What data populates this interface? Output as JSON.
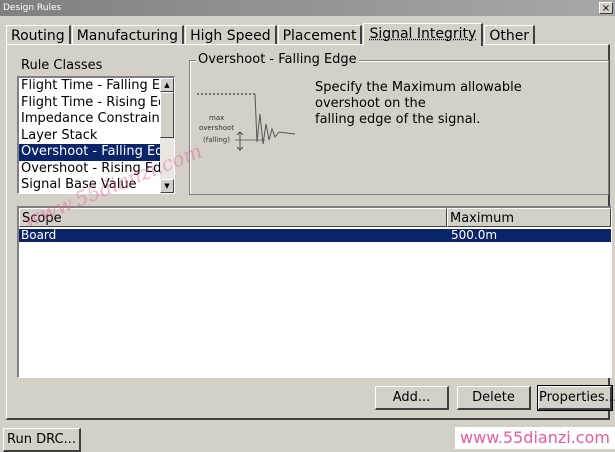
{
  "window": {
    "title": "Design Rules",
    "close_glyph": "×"
  },
  "tabs": [
    {
      "label": "Routing",
      "active": false
    },
    {
      "label": "Manufacturing",
      "active": false
    },
    {
      "label": "High Speed",
      "active": false
    },
    {
      "label": "Placement",
      "active": false
    },
    {
      "label": "Signal Integrity",
      "active": true
    },
    {
      "label": "Other",
      "active": false
    }
  ],
  "rule_classes": {
    "label": "Rule Classes",
    "items": [
      "Flight Time - Falling Edge",
      "Flight Time - Rising Edge",
      "Impedance Constraint",
      "Layer Stack",
      "Overshoot - Falling Edge",
      "Overshoot - Rising Edge",
      "Signal Base Value"
    ],
    "selected_index": 4
  },
  "description": {
    "title": "Overshoot - Falling Edge",
    "lines": [
      "Specify the Maximum allowable",
      "overshoot on the",
      "falling edge of the signal."
    ],
    "diagram_labels": [
      "max",
      "overshoot",
      "(falling)"
    ]
  },
  "rules_table": {
    "headers": [
      "Scope",
      "Maximum"
    ],
    "rows": [
      {
        "scope": "Board",
        "maximum": "500.0m"
      }
    ]
  },
  "buttons": {
    "add": "Add...",
    "delete": "Delete",
    "properties": "Properties...",
    "run_drc": "Run DRC..."
  },
  "watermark": {
    "corner_text": "www.55dianzi.com",
    "diagonal_text": "www.55dianzi.com"
  },
  "colors": {
    "selection": "#0a246a",
    "face": "#d4d0c8",
    "watermark": "#f05a9a"
  }
}
